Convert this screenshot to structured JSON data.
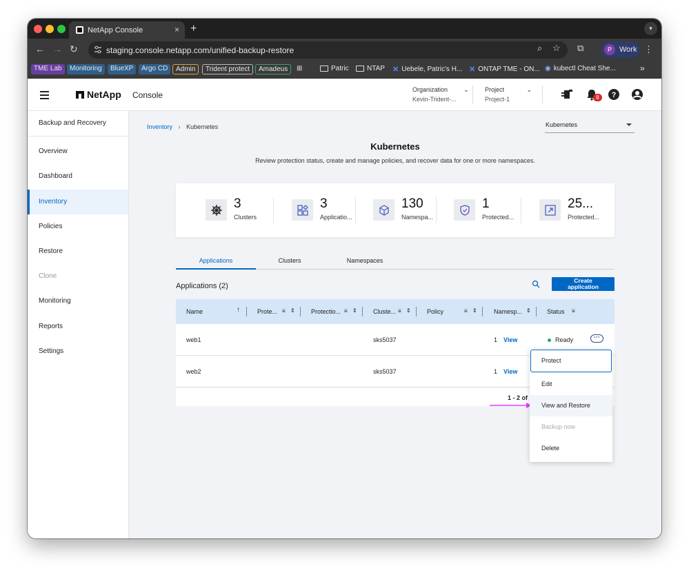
{
  "browser": {
    "tab_title": "NetApp Console",
    "tab_close": "×",
    "new_tab": "+",
    "url": "staging.console.netapp.com/unified-backup-restore",
    "profile_initial": "P",
    "profile_name": "Work",
    "bookmarks": [
      {
        "label": "TME Lab",
        "color": "#6a3fa0"
      },
      {
        "label": "Monitoring",
        "color": "#2f5f8a"
      },
      {
        "label": "BlueXP",
        "color": "#2f5f8a"
      },
      {
        "label": "Argo CD",
        "color": "#2f5f8a"
      },
      {
        "label": "Admin",
        "color": "#e0a33a"
      },
      {
        "label": "Trident protect",
        "color": "#bbbbbb"
      },
      {
        "label": "Amadeus",
        "color": "#3aa36a"
      }
    ],
    "bookmark_links": [
      "Patric",
      "NTAP",
      "Uebele, Patric's H...",
      "ONTAP TME - ON...",
      "kubectl Cheat She..."
    ],
    "bookmark_more": "»"
  },
  "header": {
    "logo": "NetApp",
    "console": "Console",
    "org_label": "Organization",
    "org_value": "Kevin-Trident-...",
    "project_label": "Project",
    "project_value": "Project-1",
    "notif_count": "8"
  },
  "sidebar": {
    "title": "Backup and Recovery",
    "items": [
      {
        "label": "Overview"
      },
      {
        "label": "Dashboard"
      },
      {
        "label": "Inventory"
      },
      {
        "label": "Policies"
      },
      {
        "label": "Restore"
      },
      {
        "label": "Clone"
      },
      {
        "label": "Monitoring"
      },
      {
        "label": "Reports"
      },
      {
        "label": "Settings"
      }
    ],
    "active": "Inventory",
    "disabled": "Clone"
  },
  "breadcrumb": {
    "root": "Inventory",
    "sep": "›",
    "current": "Kubernetes"
  },
  "workload_select": "Kubernetes",
  "page": {
    "title": "Kubernetes",
    "subtitle": "Review protection status, create and manage policies, and recover data for one or more namespaces."
  },
  "stats": [
    {
      "value": "3",
      "label": "Clusters",
      "icon": "helm-wheel-icon"
    },
    {
      "value": "3",
      "label": "Applicatio...",
      "icon": "apps-icon"
    },
    {
      "value": "130",
      "label": "Namespa...",
      "icon": "cube-icon"
    },
    {
      "value": "1",
      "label": "Protected...",
      "icon": "shield-icon"
    },
    {
      "value": "25...",
      "label": "Protected...",
      "icon": "expand-icon"
    }
  ],
  "tabs": [
    "Applications",
    "Clusters",
    "Namespaces"
  ],
  "apps_heading": "Applications (2)",
  "create_button": [
    "Create",
    "application"
  ],
  "table": {
    "columns": [
      "Name",
      "Prote...",
      "Protectio...",
      "Cluste...",
      "Policy",
      "Namesp...",
      "Status"
    ],
    "rows": [
      {
        "name": "web1",
        "cluster": "sks5037",
        "namespaces": "1",
        "view": "View",
        "status": "Ready"
      },
      {
        "name": "web2",
        "cluster": "sks5037",
        "namespaces": "1",
        "view": "View",
        "status": ""
      }
    ],
    "footer": "1 - 2 of"
  },
  "menu": [
    "Protect",
    "Edit",
    "View and Restore",
    "Backup now",
    "Delete"
  ],
  "colors": {
    "accent": "#0067c5",
    "arrow": "#e040fb",
    "ready": "#2aa55b"
  }
}
